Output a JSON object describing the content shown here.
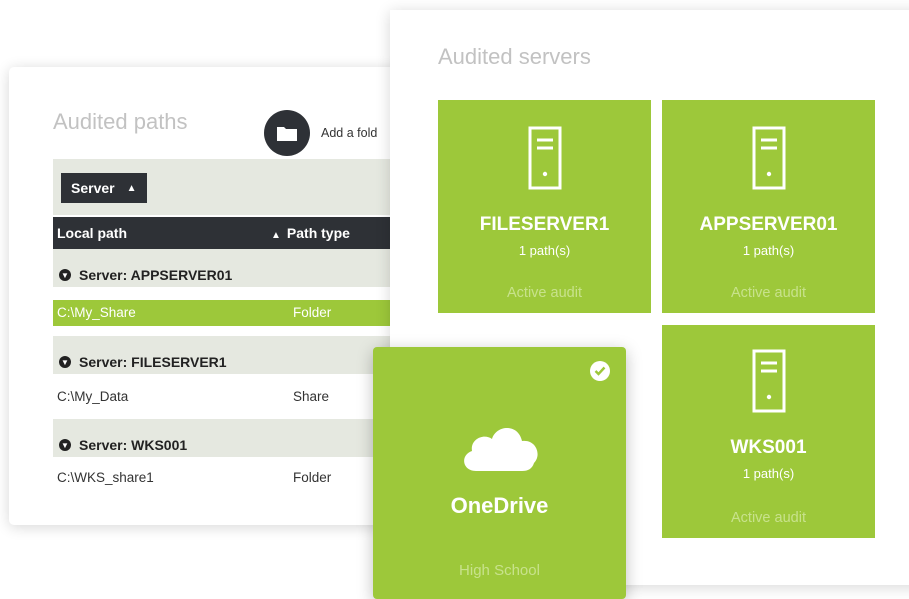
{
  "paths_panel": {
    "title": "Audited paths",
    "add_folder_label": "Add a fold",
    "group_by_chip": "Server",
    "columns": [
      "Local path",
      "Path type"
    ],
    "groups": [
      {
        "label": "Server: APPSERVER01",
        "rows": [
          {
            "path": "C:\\My_Share",
            "type": "Folder"
          }
        ]
      },
      {
        "label": "Server: FILESERVER1",
        "rows": [
          {
            "path": "C:\\My_Data",
            "type": "Share"
          }
        ]
      },
      {
        "label": "Server: WKS001",
        "rows": [
          {
            "path": "C:\\WKS_share1",
            "type": "Folder"
          }
        ]
      }
    ]
  },
  "servers_panel": {
    "title": "Audited servers",
    "tiles": [
      {
        "name": "FILESERVER1",
        "paths": "1 path(s)",
        "status": "Active audit",
        "icon": "server-icon"
      },
      {
        "name": "APPSERVER01",
        "paths": "1 path(s)",
        "status": "Active audit",
        "icon": "server-icon"
      },
      {
        "name": "WKS001",
        "paths": "1 path(s)",
        "status": "Active audit",
        "icon": "server-icon"
      }
    ]
  },
  "onedrive_tile": {
    "name": "OneDrive",
    "status": "High School",
    "icon": "cloud-icon",
    "checked": true
  },
  "colors": {
    "accent": "#9dc83a",
    "dark": "#2e3136",
    "muted_text": "#c2c2c2",
    "group_bg": "#e5e8e0"
  }
}
